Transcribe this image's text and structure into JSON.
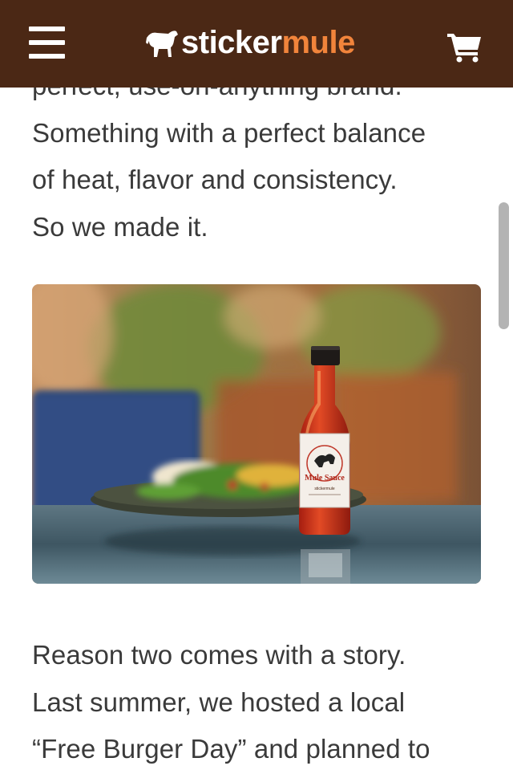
{
  "header": {
    "logo_part1": "sticker",
    "logo_part2": "mule",
    "logo_icon": "mule-icon",
    "menu_icon": "hamburger-menu-icon",
    "cart_icon": "shopping-cart-icon"
  },
  "article": {
    "paragraph1_lines": [
      "perfect, use-on-anything brand.",
      "Something with a perfect balance",
      "of heat, flavor and consistency.",
      "So we made it."
    ],
    "paragraph2_lines": [
      "Reason two comes with a story.",
      "Last summer, we hosted a local",
      "“Free Burger Day” and planned to"
    ]
  },
  "photo": {
    "label_brand": "Mule Sauce",
    "label_small": "stickermule"
  },
  "colors": {
    "header_bg": "#4b2815",
    "brand_orange": "#f1843b",
    "text": "#3a3a3a"
  }
}
